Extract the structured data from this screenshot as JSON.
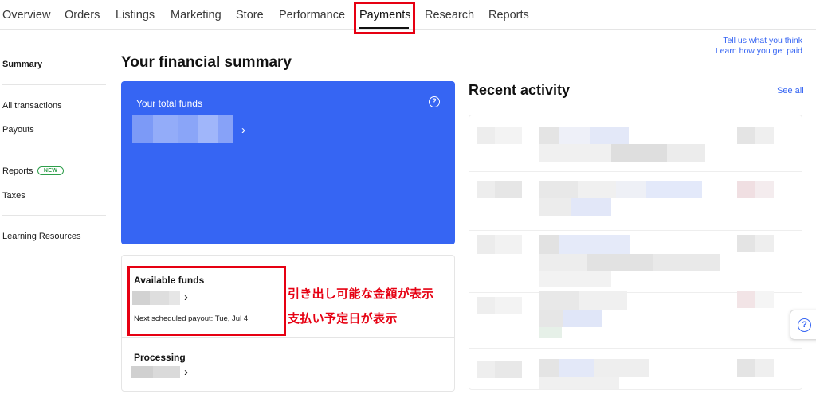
{
  "nav": {
    "tabs": [
      {
        "label": "Overview"
      },
      {
        "label": "Orders"
      },
      {
        "label": "Listings"
      },
      {
        "label": "Marketing"
      },
      {
        "label": "Store"
      },
      {
        "label": "Performance"
      },
      {
        "label": "Payments",
        "active": true
      },
      {
        "label": "Research"
      },
      {
        "label": "Reports"
      }
    ]
  },
  "feedback": {
    "tell_us": "Tell us what you think",
    "learn_more": "Learn how you get paid"
  },
  "sidebar": {
    "items": [
      {
        "label": "Summary",
        "active": true
      },
      {
        "label": "All transactions"
      },
      {
        "label": "Payouts"
      },
      {
        "label": "Reports",
        "badge": "NEW"
      },
      {
        "label": "Taxes"
      },
      {
        "label": "Learning Resources"
      }
    ]
  },
  "main": {
    "title": "Your financial summary",
    "total_funds": {
      "label": "Your total funds",
      "help_icon": "question-circle-icon"
    },
    "available_funds": {
      "label": "Available funds",
      "next_payout": "Next scheduled payout: Tue, Jul 4"
    },
    "processing": {
      "label": "Processing"
    }
  },
  "activity": {
    "title": "Recent activity",
    "see_all": "See all"
  },
  "annotations": {
    "note_1": "引き出し可能な金額が表示",
    "note_2": "支払い予定日が表示"
  },
  "colors": {
    "accent": "#3665f3",
    "highlight": "#e60012"
  },
  "help_fab_icon": "question-circle-icon"
}
